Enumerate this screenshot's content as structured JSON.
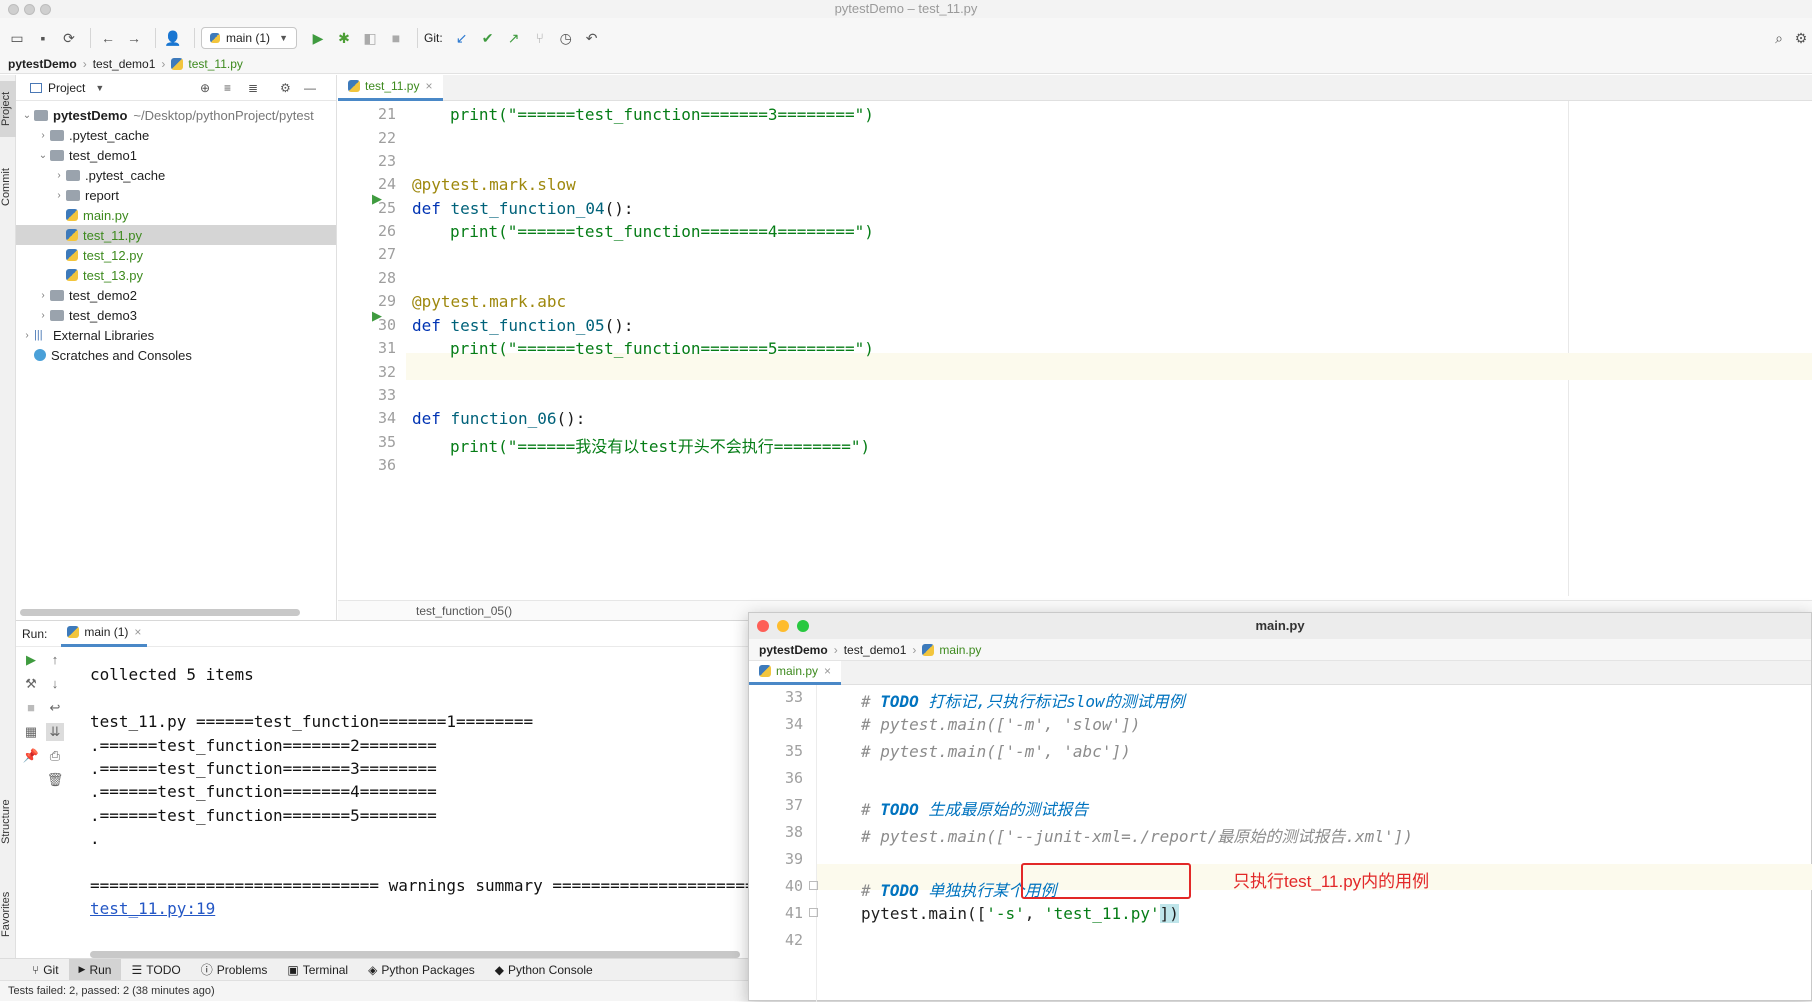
{
  "window": {
    "title": "pytestDemo – test_11.py"
  },
  "toolbar": {
    "run_config": "main (1)",
    "git_label": "Git:"
  },
  "breadcrumb": [
    "pytestDemo",
    "test_demo1",
    "test_11.py"
  ],
  "sidebar_tabs": {
    "project": "Project",
    "commit": "Commit",
    "structure": "Structure",
    "favorites": "Favorites"
  },
  "project": {
    "header": "Project",
    "root_name": "pytestDemo",
    "root_path": "~/Desktop/pythonProject/pytest",
    "items": [
      {
        "label": ".pytest_cache"
      },
      {
        "label": "test_demo1"
      },
      {
        "label": ".pytest_cache"
      },
      {
        "label": "report"
      },
      {
        "label": "main.py"
      },
      {
        "label": "test_11.py"
      },
      {
        "label": "test_12.py"
      },
      {
        "label": "test_13.py"
      },
      {
        "label": "test_demo2"
      },
      {
        "label": "test_demo3"
      },
      {
        "label": "External Libraries"
      },
      {
        "label": "Scratches and Consoles"
      }
    ]
  },
  "editor": {
    "tab": "test_11.py",
    "footer": "test_function_05()",
    "line_numbers": [
      "21",
      "22",
      "23",
      "24",
      "25",
      "26",
      "27",
      "28",
      "29",
      "30",
      "31",
      "32",
      "33",
      "34",
      "35",
      "36"
    ],
    "lines": {
      "l21": "print(\"======test_function=======3========\")",
      "l24": "@pytest.mark.slow",
      "l25_kw": "def ",
      "l25_fn": "test_function_04",
      "l25_end": "():",
      "l26": "print(\"======test_function=======4========\")",
      "l29": "@pytest.mark.abc",
      "l30_kw": "def ",
      "l30_fn": "test_function_05",
      "l30_end": "():",
      "l31": "print(\"======test_function=======5========\")",
      "l34_kw": "def ",
      "l34_fn": "function_06",
      "l34_end": "():",
      "l35": "print(\"======我没有以test开头不会执行========\")"
    }
  },
  "run": {
    "label": "Run:",
    "tab": "main (1)",
    "output": [
      "collected 5 items",
      "",
      "test_11.py ======test_function=======1========",
      ".======test_function=======2========",
      ".======test_function=======3========",
      ".======test_function=======4========",
      ".======test_function=======5========",
      ".",
      "",
      "============================== warnings summary ====================="
    ],
    "link": "test_11.py:19"
  },
  "toolwindows": [
    "Git",
    "Run",
    "TODO",
    "Problems",
    "Terminal",
    "Python Packages",
    "Python Console"
  ],
  "status": "Tests failed: 2, passed: 2 (38 minutes ago)",
  "main_window": {
    "title": "main.py",
    "breadcrumb": [
      "pytestDemo",
      "test_demo1",
      "main.py"
    ],
    "tab": "main.py",
    "line_numbers": [
      "33",
      "34",
      "35",
      "36",
      "37",
      "38",
      "39",
      "40",
      "41",
      "42"
    ],
    "c33_todo": "TODO",
    "c33_text": " 打标记,只执行标记slow的测试用例",
    "c34": "# pytest.main(['-m', 'slow'])",
    "c35": "# pytest.main(['-m', 'abc'])",
    "c37_todo": "TODO",
    "c37_text": " 生成最原始的测试报告",
    "c38": "# pytest.main(['--junit-xml=./report/最原始的测试报告.xml'])",
    "c40_todo": "TODO",
    "c40_text": " 单独执行某个用例",
    "c41_a": "pytest.main([",
    "c41_b": "'-s'",
    "c41_c": ", ",
    "c41_d": "'test_11.py'",
    "c41_e": "])",
    "annotation": "只执行test_11.py内的用例"
  }
}
